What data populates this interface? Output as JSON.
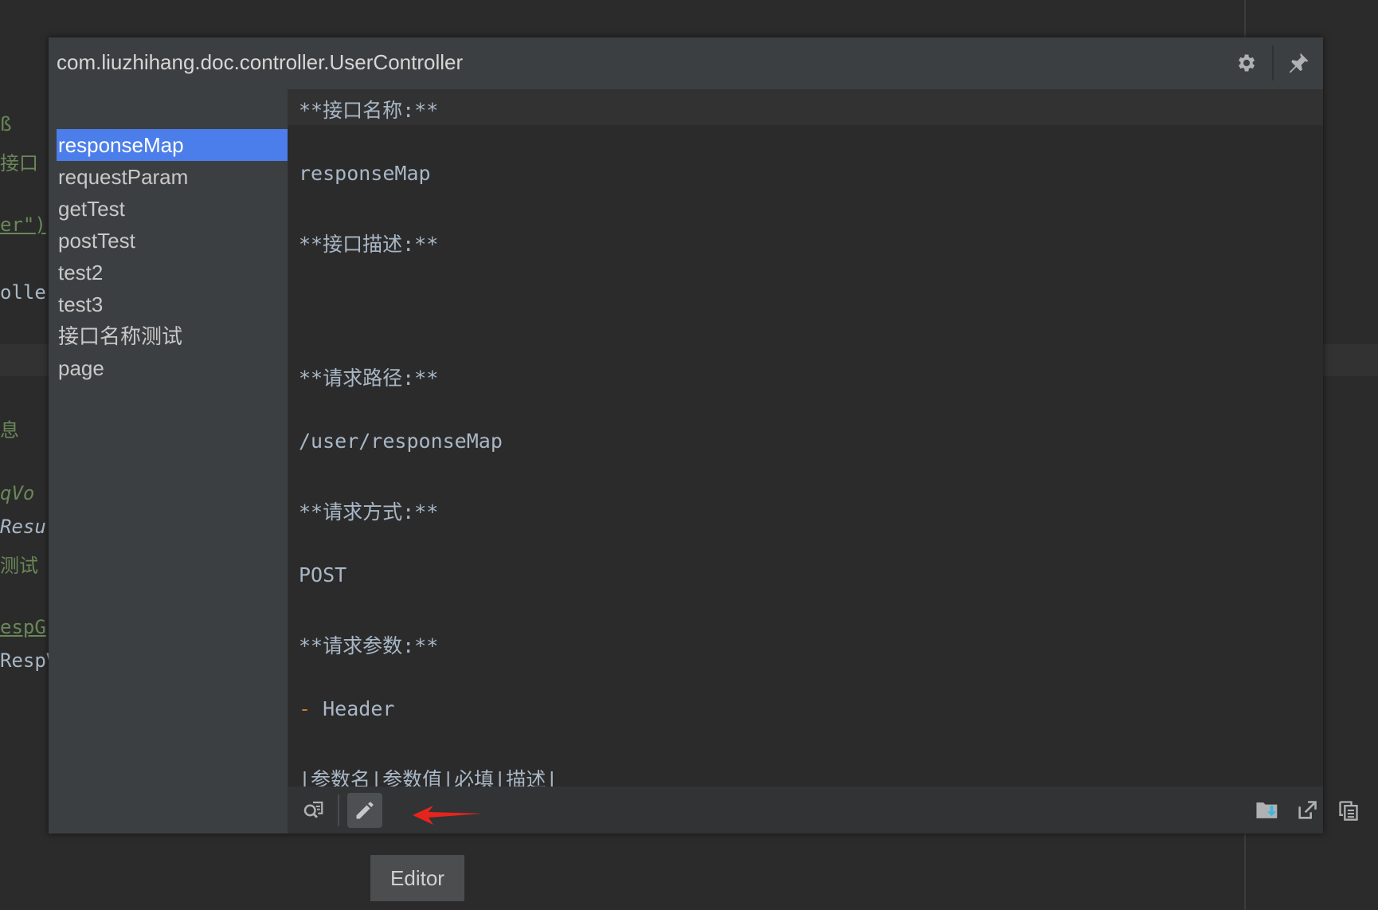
{
  "background_code": [
    {
      "text": "ß",
      "color": "#6a8759"
    },
    {
      "text": "接口",
      "color": "#6a8759"
    },
    {
      "text": "er\")",
      "color": "#6a8759"
    },
    {
      "text": "oller",
      "color": "#a9b7c6"
    },
    {
      "text": "息",
      "color": "#6a8759"
    },
    {
      "text": "qVo",
      "color": "#6a8759"
    },
    {
      "text": "Resu",
      "color": "#a9b7c6"
    },
    {
      "text": "测试",
      "color": "#6a8759"
    },
    {
      "text": "espG",
      "color": "#6a8759"
    },
    {
      "text": "RespV",
      "color": "#a9b7c6"
    }
  ],
  "popup": {
    "title": "com.liuzhihang.doc.controller.UserController",
    "header_buttons": [
      "gear-icon",
      "pin-icon"
    ]
  },
  "sidebar": {
    "items": [
      {
        "label": "responseMap",
        "selected": true
      },
      {
        "label": "requestParam",
        "selected": false
      },
      {
        "label": "getTest",
        "selected": false
      },
      {
        "label": "postTest",
        "selected": false
      },
      {
        "label": "test2",
        "selected": false
      },
      {
        "label": "test3",
        "selected": false
      },
      {
        "label": "接口名称测试",
        "selected": false
      },
      {
        "label": "page",
        "selected": false
      }
    ]
  },
  "document": {
    "lines": [
      {
        "text": "**接口名称:**"
      },
      {
        "text": "responseMap"
      },
      {
        "text": "**接口描述:**"
      },
      {
        "text": "**请求路径:**"
      },
      {
        "text": "/user/responseMap"
      },
      {
        "text": "**请求方式:**"
      },
      {
        "text": "POST"
      },
      {
        "text": "**请求参数:**"
      },
      {
        "dash": "-",
        "text": " Header"
      },
      {
        "text": "|参数名|参数值|必填|描述|"
      }
    ]
  },
  "toolbar": {
    "left_buttons": [
      "preview-search-icon",
      "pencil-edit-icon"
    ],
    "right_buttons": [
      "export-icon",
      "open-external-icon",
      "copy-icon"
    ]
  },
  "tooltip": {
    "label": "Editor"
  },
  "colors": {
    "accent": "#4b7eea",
    "arrow": "#e5251c",
    "string_green": "#6a8759"
  }
}
